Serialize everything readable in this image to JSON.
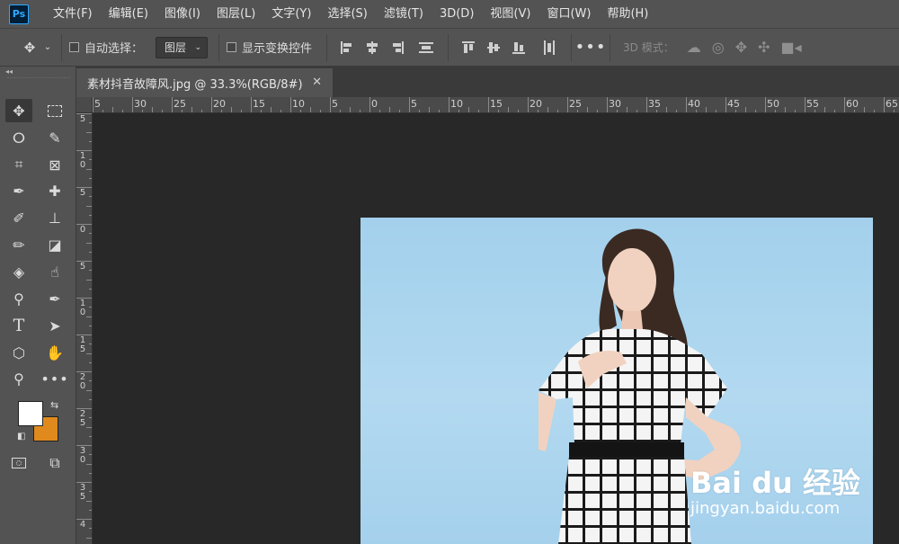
{
  "app": {
    "logo": "Ps"
  },
  "menu": [
    "文件(F)",
    "编辑(E)",
    "图像(I)",
    "图层(L)",
    "文字(Y)",
    "选择(S)",
    "滤镜(T)",
    "3D(D)",
    "视图(V)",
    "窗口(W)",
    "帮助(H)"
  ],
  "options": {
    "auto_select_label": "自动选择：",
    "auto_select_value": "图层",
    "show_transform_label": "显示变换控件",
    "mode_3d_label": "3D 模式："
  },
  "document": {
    "tab_title": "素材抖音故障风.jpg @ 33.3%(RGB/8#)",
    "close_glyph": "✕"
  },
  "ruler": {
    "top_labels": [
      "5",
      "30",
      "25",
      "20",
      "15",
      "10",
      "5",
      "0",
      "5",
      "10",
      "15",
      "20",
      "25",
      "30",
      "35",
      "40",
      "45",
      "50",
      "55",
      "60",
      "65"
    ],
    "left_labels": [
      "5",
      "1 0",
      "5",
      "0",
      "5",
      "1 0",
      "1 5",
      "2 0",
      "2 5",
      "3 0",
      "3 5",
      "4"
    ]
  },
  "colors": {
    "foreground": "#ffffff",
    "background": "#e08a1e",
    "photo_bg": "#a9d3ee"
  },
  "watermark": {
    "brand": "Bai du 经验",
    "url": "jingyan.baidu.com"
  }
}
